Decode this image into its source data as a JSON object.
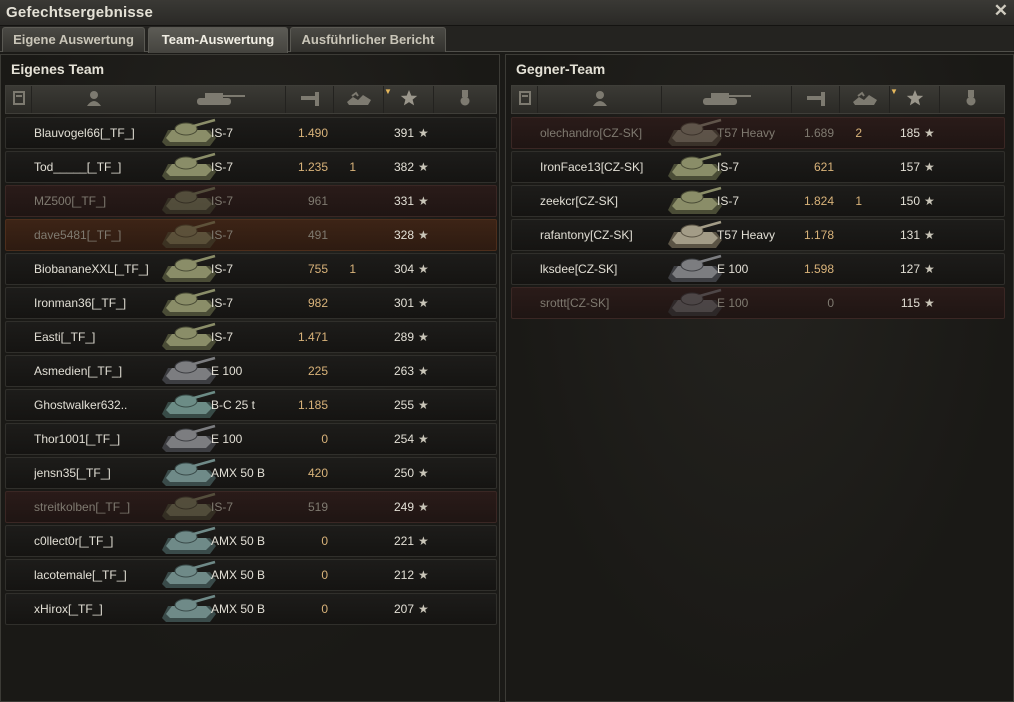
{
  "window": {
    "title": "Gefechtsergebnisse",
    "close_icon": "close-icon"
  },
  "tabs": [
    {
      "label": "Eigene Auswertung",
      "active": false
    },
    {
      "label": "Team-Auswertung",
      "active": true
    },
    {
      "label": "Ausführlicher Bericht",
      "active": false
    }
  ],
  "colors": {
    "row_alive": "#1d1c1a",
    "row_dead": "#2a1b19",
    "row_squad": "#3d2416",
    "damage_text": "#d9b37a",
    "sort_arrow": "#e6b85c"
  },
  "columns": [
    {
      "key": "squad",
      "icon": "squad-icon"
    },
    {
      "key": "player",
      "icon": "player-icon"
    },
    {
      "key": "tank",
      "icon": "tank-icon"
    },
    {
      "key": "damage",
      "icon": "damage-icon"
    },
    {
      "key": "kills",
      "icon": "kills-icon"
    },
    {
      "key": "xp",
      "icon": "star-icon",
      "sorted": true
    },
    {
      "key": "medals",
      "icon": "medal-icon"
    }
  ],
  "own_team": {
    "title": "Eigenes Team",
    "rows": [
      {
        "name": "Blauvogel66[_TF_]",
        "tank": "IS-7",
        "tank_type": "is7",
        "damage": "1.490",
        "kills": "",
        "xp": "391",
        "state": "alive"
      },
      {
        "name": "Tod_____[_TF_]",
        "tank": "IS-7",
        "tank_type": "is7",
        "damage": "1.235",
        "kills": "1",
        "xp": "382",
        "state": "alive"
      },
      {
        "name": "MZ500[_TF_]",
        "tank": "IS-7",
        "tank_type": "is7",
        "damage": "961",
        "kills": "",
        "xp": "331",
        "state": "dead"
      },
      {
        "name": "dave5481[_TF_]",
        "tank": "IS-7",
        "tank_type": "is7",
        "damage": "491",
        "kills": "",
        "xp": "328",
        "state": "squad"
      },
      {
        "name": "BiobananeXXL[_TF_]",
        "tank": "IS-7",
        "tank_type": "is7",
        "damage": "755",
        "kills": "1",
        "xp": "304",
        "state": "alive"
      },
      {
        "name": "Ironman36[_TF_]",
        "tank": "IS-7",
        "tank_type": "is7",
        "damage": "982",
        "kills": "",
        "xp": "301",
        "state": "alive"
      },
      {
        "name": "Easti[_TF_]",
        "tank": "IS-7",
        "tank_type": "is7",
        "damage": "1.471",
        "kills": "",
        "xp": "289",
        "state": "alive"
      },
      {
        "name": "Asmedien[_TF_]",
        "tank": "E 100",
        "tank_type": "e100",
        "damage": "225",
        "kills": "",
        "xp": "263",
        "state": "alive"
      },
      {
        "name": "Ghostwalker632..",
        "tank": "B-C 25 t",
        "tank_type": "bc25t",
        "damage": "1.185",
        "kills": "",
        "xp": "255",
        "state": "alive"
      },
      {
        "name": "Thor1001[_TF_]",
        "tank": "E 100",
        "tank_type": "e100",
        "damage": "0",
        "kills": "",
        "xp": "254",
        "state": "alive"
      },
      {
        "name": "jensn35[_TF_]",
        "tank": "AMX 50 B",
        "tank_type": "amx",
        "damage": "420",
        "kills": "",
        "xp": "250",
        "state": "alive"
      },
      {
        "name": "streitkolben[_TF_]",
        "tank": "IS-7",
        "tank_type": "is7",
        "damage": "519",
        "kills": "",
        "xp": "249",
        "state": "dead"
      },
      {
        "name": "c0llect0r[_TF_]",
        "tank": "AMX 50 B",
        "tank_type": "amx",
        "damage": "0",
        "kills": "",
        "xp": "221",
        "state": "alive"
      },
      {
        "name": "lacotemale[_TF_]",
        "tank": "AMX 50 B",
        "tank_type": "amx",
        "damage": "0",
        "kills": "",
        "xp": "212",
        "state": "alive"
      },
      {
        "name": "xHirox[_TF_]",
        "tank": "AMX 50 B",
        "tank_type": "amx",
        "damage": "0",
        "kills": "",
        "xp": "207",
        "state": "alive"
      }
    ]
  },
  "enemy_team": {
    "title": "Gegner-Team",
    "rows": [
      {
        "name": "olechandro[CZ-SK]",
        "tank": "T57 Heavy",
        "tank_type": "t57",
        "damage": "1.689",
        "kills": "2",
        "xp": "185",
        "state": "dead"
      },
      {
        "name": "IronFace13[CZ-SK]",
        "tank": "IS-7",
        "tank_type": "is7",
        "damage": "621",
        "kills": "",
        "xp": "157",
        "state": "alive"
      },
      {
        "name": "zeekcr[CZ-SK]",
        "tank": "IS-7",
        "tank_type": "is7",
        "damage": "1.824",
        "kills": "1",
        "xp": "150",
        "state": "alive"
      },
      {
        "name": "rafantony[CZ-SK]",
        "tank": "T57 Heavy",
        "tank_type": "t57",
        "damage": "1.178",
        "kills": "",
        "xp": "131",
        "state": "alive"
      },
      {
        "name": "lksdee[CZ-SK]",
        "tank": "E 100",
        "tank_type": "e100",
        "damage": "1.598",
        "kills": "",
        "xp": "127",
        "state": "alive"
      },
      {
        "name": "srottt[CZ-SK]",
        "tank": "E 100",
        "tank_type": "e100",
        "damage": "0",
        "kills": "",
        "xp": "115",
        "state": "dead"
      }
    ]
  }
}
